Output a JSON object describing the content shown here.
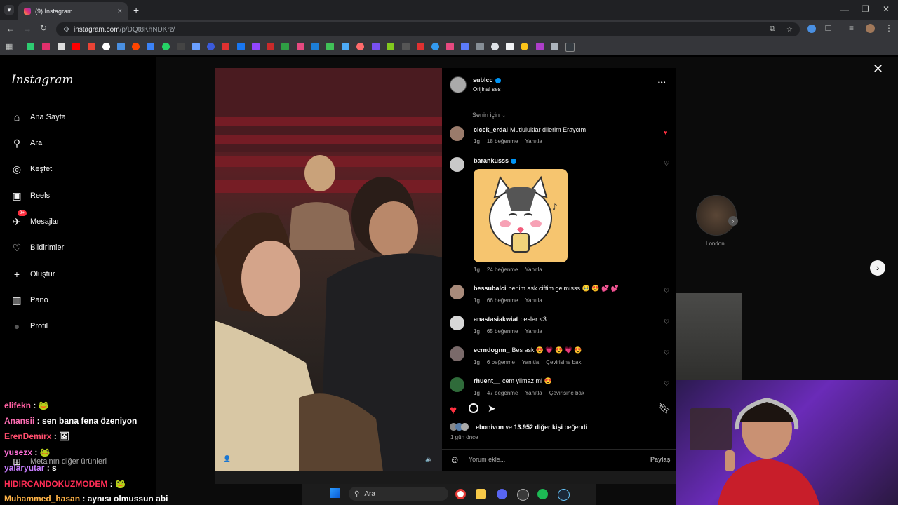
{
  "browser": {
    "tab_title": "(9) Instagram",
    "tab_close": "×",
    "new_tab": "+",
    "url_host": "instagram.com",
    "url_path": "/p/DQt8KhNDKrz/"
  },
  "sidebar": {
    "logo": "Instagram",
    "items": [
      {
        "label": "Ana Sayfa",
        "icon": "home-icon",
        "glyph": "⌂"
      },
      {
        "label": "Ara",
        "icon": "search-icon",
        "glyph": "⚲"
      },
      {
        "label": "Keşfet",
        "icon": "compass-icon",
        "glyph": "◎"
      },
      {
        "label": "Reels",
        "icon": "reels-icon",
        "glyph": "▣"
      },
      {
        "label": "Mesajlar",
        "icon": "messages-icon",
        "glyph": "✈",
        "badge": "9+"
      },
      {
        "label": "Bildirimler",
        "icon": "heart-icon",
        "glyph": "♡"
      },
      {
        "label": "Oluştur",
        "icon": "plus-icon",
        "glyph": "+"
      },
      {
        "label": "Pano",
        "icon": "dashboard-icon",
        "glyph": "▥"
      },
      {
        "label": "Profil",
        "icon": "profile-icon",
        "glyph": "●"
      }
    ],
    "more": "Meta'nın diğer ürünleri"
  },
  "post": {
    "author": "sublcc",
    "audio": "Orijinal ses",
    "more": "•••",
    "for_you": "Senin için",
    "likes_by": "ebonivon",
    "likes_rest": " ve ",
    "likes_count": "13.952 diğer kişi",
    "likes_suffix": " beğendi",
    "time": "1 gün önce",
    "comment_placeholder": "Yorum ekle...",
    "share": "Paylaş",
    "side_label": "London"
  },
  "comments": [
    {
      "user": "cicek_erdal",
      "text": "Mutluluklar dilerim Eraycım",
      "age": "1g",
      "likes": "18 beğenme",
      "reply": "Yanıtla",
      "liked": true,
      "verified": false
    },
    {
      "user": "barankusss",
      "text": "",
      "age": "1g",
      "likes": "24 beğenme",
      "reply": "Yanıtla",
      "liked": false,
      "verified": true
    },
    {
      "user": "bessubalci",
      "text": "benim ask ciftim gelmısss 🥹 😍 💕 💕",
      "age": "1g",
      "likes": "66 beğenme",
      "reply": "Yanıtla",
      "liked": false,
      "verified": false
    },
    {
      "user": "anastasiakwiat",
      "text": "besler <3",
      "age": "1g",
      "likes": "65 beğenme",
      "reply": "Yanıtla",
      "liked": false,
      "verified": false
    },
    {
      "user": "ecrndognn_",
      "text": "Bes aski😍 💗 😍 💗 😍",
      "age": "1g",
      "likes": "6 beğenme",
      "reply": "Yanıtla",
      "translate": "Çevirisine bak",
      "liked": false,
      "verified": false
    },
    {
      "user": "rhuent__",
      "text": "cem yilmaz mi 😍",
      "age": "1g",
      "likes": "47 beğenme",
      "reply": "Yanıtla",
      "translate": "Çevirisine bak",
      "liked": false,
      "verified": false
    }
  ],
  "chat": [
    {
      "user": "elifekn",
      "text": "🐸",
      "color": "#ff5fa2"
    },
    {
      "user": "Anansii",
      "text": "sen bana fena özeniyon",
      "color": "#ff6fb5"
    },
    {
      "user": "ErenDemirx",
      "text": "🖼",
      "color": "#ff4d6d"
    },
    {
      "user": "yusezx",
      "text": "🐸",
      "color": "#ff6fd8"
    },
    {
      "user": "yalaryutar",
      "text": "s",
      "color": "#c77dff"
    },
    {
      "user": "HIDIRCANDOKUZMODEM",
      "text": "🐸",
      "color": "#ff2d55"
    },
    {
      "user": "Muhammed_hasan",
      "text": "aynısı olmussun abi",
      "color": "#ffb347"
    }
  ],
  "taskbar": {
    "search": "Ara"
  },
  "colors": {
    "accent": "#0095f6",
    "like": "#ff3040"
  }
}
